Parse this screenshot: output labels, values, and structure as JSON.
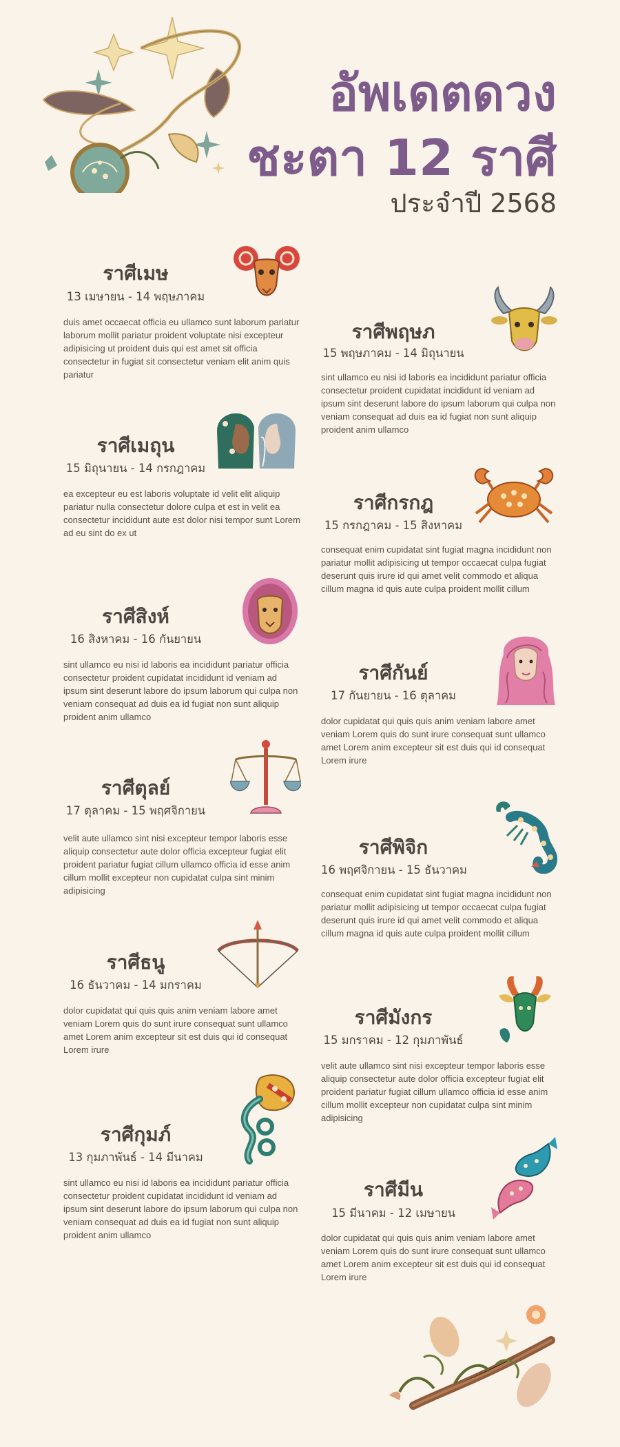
{
  "header": {
    "title_line1": "อัพเดตดวง",
    "title_line2": "ชะตา 12 ราศี",
    "subtitle": "ประจำปี 2568"
  },
  "signs": [
    {
      "name": "ราศีเมษ",
      "dates": "13 เมษายน - 14 พฤษภาคม",
      "desc": "duis amet occaecat officia eu ullamco sunt laborum pariatur laborum mollit pariatur proident voluptate nisi excepteur adipisicing ut proident duis qui est amet sit officia consectetur in fugiat sit consectetur veniam elit anim quis pariatur",
      "icon": "ram-icon"
    },
    {
      "name": "ราศีพฤษภ",
      "dates": "15 พฤษภาคม - 14 มิถุนายน",
      "desc": "sint ullamco eu nisi id laboris ea incididunt pariatur officia consectetur proident cupidatat incididunt id veniam ad ipsum sint deserunt labore do ipsum laborum qui culpa non veniam consequat ad duis ea id fugiat non sunt aliquip proident anim ullamco",
      "icon": "bull-icon"
    },
    {
      "name": "ราศีเมถุน",
      "dates": "15 มิถุนายน - 14 กรกฎาคม",
      "desc": "ea excepteur eu est laboris voluptate id velit elit aliquip pariatur nulla consectetur dolore culpa et est in velit ea consectetur incididunt aute est dolor nisi tempor sunt Lorem ad eu sint do ex ut",
      "icon": "twins-icon"
    },
    {
      "name": "ราศีกรกฎ",
      "dates": "15 กรกฎาคม - 15 สิงหาคม",
      "desc": "consequat enim cupidatat sint fugiat magna incididunt non pariatur mollit adipisicing ut tempor occaecat culpa fugiat deserunt quis irure id qui amet velit commodo et aliqua cillum magna id quis aute culpa proident mollit cillum",
      "icon": "crab-icon"
    },
    {
      "name": "ราศีสิงห์",
      "dates": "16 สิงหาคม - 16 กันยายน",
      "desc": "sint ullamco eu nisi id laboris ea incididunt pariatur officia consectetur proident cupidatat incididunt id veniam ad ipsum sint deserunt labore do ipsum laborum qui culpa non veniam consequat ad duis ea id fugiat non sunt aliquip proident anim ullamco",
      "icon": "lion-icon"
    },
    {
      "name": "ราศีกันย์",
      "dates": "17 กันยายน - 16 ตุลาคม",
      "desc": "dolor cupidatat qui quis quis anim veniam labore amet veniam Lorem quis do sunt irure consequat sunt ullamco amet Lorem anim excepteur sit est duis qui id consequat Lorem irure",
      "icon": "maiden-icon"
    },
    {
      "name": "ราศีตุลย์",
      "dates": "17 ตุลาคม - 15 พฤศจิกายน",
      "desc": "velit aute ullamco sint nisi excepteur tempor laboris esse aliquip consectetur aute dolor officia excepteur fugiat elit proident pariatur fugiat cillum ullamco officia id esse anim cillum mollit excepteur non cupidatat culpa sint minim adipisicing",
      "icon": "scales-icon"
    },
    {
      "name": "ราศีพิจิก",
      "dates": "16 พฤศจิกายน - 15 ธันวาคม",
      "desc": "consequat enim cupidatat sint fugiat magna incididunt non pariatur mollit adipisicing ut tempor occaecat culpa fugiat deserunt quis irure id qui amet velit commodo et aliqua cillum magna id quis aute culpa proident mollit cillum",
      "icon": "scorpion-icon"
    },
    {
      "name": "ราศีธนู",
      "dates": "16 ธันวาคม - 14 มกราคม",
      "desc": "dolor cupidatat qui quis quis anim veniam labore amet veniam Lorem quis do sunt irure consequat sunt ullamco amet Lorem anim excepteur sit est duis qui id consequat Lorem irure",
      "icon": "bow-arrow-icon"
    },
    {
      "name": "ราศีมังกร",
      "dates": "15 มกราคม - 12 กุมภาพันธ์",
      "desc": "velit aute ullamco sint nisi excepteur tempor laboris esse aliquip consectetur aute dolor officia excepteur fugiat elit proident pariatur fugiat cillum ullamco officia id esse anim cillum mollit excepteur non cupidatat culpa sint minim adipisicing",
      "icon": "sea-goat-icon"
    },
    {
      "name": "ราศีกุมภ์",
      "dates": "13 กุมภาพันธ์ - 14 มีนาคม",
      "desc": "sint ullamco eu nisi id laboris ea incididunt pariatur officia consectetur proident cupidatat incididunt id veniam ad ipsum sint deserunt labore do ipsum laborum qui culpa non veniam consequat ad duis ea id fugiat non sunt aliquip proident anim ullamco",
      "icon": "water-bearer-icon"
    },
    {
      "name": "ราศีมีน",
      "dates": "15 มีนาคม - 12 เมษายน",
      "desc": "dolor cupidatat qui quis quis anim veniam labore amet veniam Lorem quis do sunt irure consequat sunt ullamco amet Lorem anim excepteur sit est duis qui id consequat Lorem irure",
      "icon": "fish-icon"
    }
  ]
}
